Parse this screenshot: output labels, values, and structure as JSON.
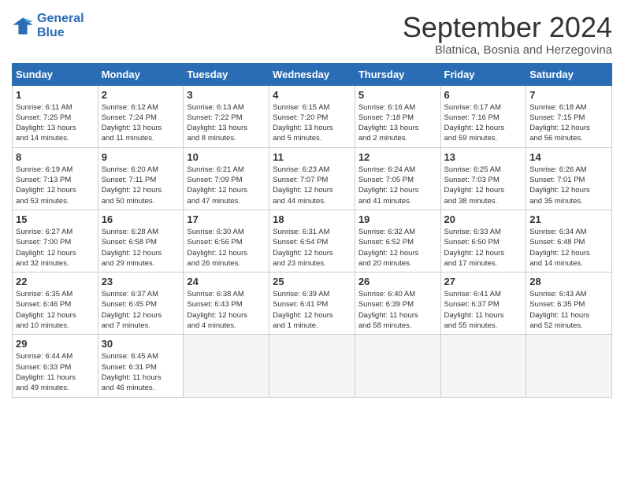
{
  "logo": {
    "line1": "General",
    "line2": "Blue"
  },
  "title": "September 2024",
  "subtitle": "Blatnica, Bosnia and Herzegovina",
  "days_of_week": [
    "Sunday",
    "Monday",
    "Tuesday",
    "Wednesday",
    "Thursday",
    "Friday",
    "Saturday"
  ],
  "weeks": [
    [
      {
        "num": "1",
        "info": "Sunrise: 6:11 AM\nSunset: 7:25 PM\nDaylight: 13 hours\nand 14 minutes."
      },
      {
        "num": "2",
        "info": "Sunrise: 6:12 AM\nSunset: 7:24 PM\nDaylight: 13 hours\nand 11 minutes."
      },
      {
        "num": "3",
        "info": "Sunrise: 6:13 AM\nSunset: 7:22 PM\nDaylight: 13 hours\nand 8 minutes."
      },
      {
        "num": "4",
        "info": "Sunrise: 6:15 AM\nSunset: 7:20 PM\nDaylight: 13 hours\nand 5 minutes."
      },
      {
        "num": "5",
        "info": "Sunrise: 6:16 AM\nSunset: 7:18 PM\nDaylight: 13 hours\nand 2 minutes."
      },
      {
        "num": "6",
        "info": "Sunrise: 6:17 AM\nSunset: 7:16 PM\nDaylight: 12 hours\nand 59 minutes."
      },
      {
        "num": "7",
        "info": "Sunrise: 6:18 AM\nSunset: 7:15 PM\nDaylight: 12 hours\nand 56 minutes."
      }
    ],
    [
      {
        "num": "8",
        "info": "Sunrise: 6:19 AM\nSunset: 7:13 PM\nDaylight: 12 hours\nand 53 minutes."
      },
      {
        "num": "9",
        "info": "Sunrise: 6:20 AM\nSunset: 7:11 PM\nDaylight: 12 hours\nand 50 minutes."
      },
      {
        "num": "10",
        "info": "Sunrise: 6:21 AM\nSunset: 7:09 PM\nDaylight: 12 hours\nand 47 minutes."
      },
      {
        "num": "11",
        "info": "Sunrise: 6:23 AM\nSunset: 7:07 PM\nDaylight: 12 hours\nand 44 minutes."
      },
      {
        "num": "12",
        "info": "Sunrise: 6:24 AM\nSunset: 7:05 PM\nDaylight: 12 hours\nand 41 minutes."
      },
      {
        "num": "13",
        "info": "Sunrise: 6:25 AM\nSunset: 7:03 PM\nDaylight: 12 hours\nand 38 minutes."
      },
      {
        "num": "14",
        "info": "Sunrise: 6:26 AM\nSunset: 7:01 PM\nDaylight: 12 hours\nand 35 minutes."
      }
    ],
    [
      {
        "num": "15",
        "info": "Sunrise: 6:27 AM\nSunset: 7:00 PM\nDaylight: 12 hours\nand 32 minutes."
      },
      {
        "num": "16",
        "info": "Sunrise: 6:28 AM\nSunset: 6:58 PM\nDaylight: 12 hours\nand 29 minutes."
      },
      {
        "num": "17",
        "info": "Sunrise: 6:30 AM\nSunset: 6:56 PM\nDaylight: 12 hours\nand 26 minutes."
      },
      {
        "num": "18",
        "info": "Sunrise: 6:31 AM\nSunset: 6:54 PM\nDaylight: 12 hours\nand 23 minutes."
      },
      {
        "num": "19",
        "info": "Sunrise: 6:32 AM\nSunset: 6:52 PM\nDaylight: 12 hours\nand 20 minutes."
      },
      {
        "num": "20",
        "info": "Sunrise: 6:33 AM\nSunset: 6:50 PM\nDaylight: 12 hours\nand 17 minutes."
      },
      {
        "num": "21",
        "info": "Sunrise: 6:34 AM\nSunset: 6:48 PM\nDaylight: 12 hours\nand 14 minutes."
      }
    ],
    [
      {
        "num": "22",
        "info": "Sunrise: 6:35 AM\nSunset: 6:46 PM\nDaylight: 12 hours\nand 10 minutes."
      },
      {
        "num": "23",
        "info": "Sunrise: 6:37 AM\nSunset: 6:45 PM\nDaylight: 12 hours\nand 7 minutes."
      },
      {
        "num": "24",
        "info": "Sunrise: 6:38 AM\nSunset: 6:43 PM\nDaylight: 12 hours\nand 4 minutes."
      },
      {
        "num": "25",
        "info": "Sunrise: 6:39 AM\nSunset: 6:41 PM\nDaylight: 12 hours\nand 1 minute."
      },
      {
        "num": "26",
        "info": "Sunrise: 6:40 AM\nSunset: 6:39 PM\nDaylight: 11 hours\nand 58 minutes."
      },
      {
        "num": "27",
        "info": "Sunrise: 6:41 AM\nSunset: 6:37 PM\nDaylight: 11 hours\nand 55 minutes."
      },
      {
        "num": "28",
        "info": "Sunrise: 6:43 AM\nSunset: 6:35 PM\nDaylight: 11 hours\nand 52 minutes."
      }
    ],
    [
      {
        "num": "29",
        "info": "Sunrise: 6:44 AM\nSunset: 6:33 PM\nDaylight: 11 hours\nand 49 minutes."
      },
      {
        "num": "30",
        "info": "Sunrise: 6:45 AM\nSunset: 6:31 PM\nDaylight: 11 hours\nand 46 minutes."
      },
      {
        "num": "",
        "info": ""
      },
      {
        "num": "",
        "info": ""
      },
      {
        "num": "",
        "info": ""
      },
      {
        "num": "",
        "info": ""
      },
      {
        "num": "",
        "info": ""
      }
    ]
  ]
}
